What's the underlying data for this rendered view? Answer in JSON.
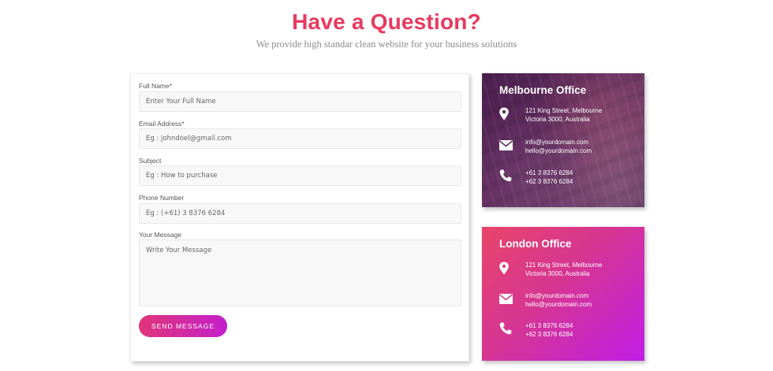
{
  "header": {
    "title": "Have a Question?",
    "subtitle": "We provide high standar clean website for your business solutions"
  },
  "form": {
    "fields": [
      {
        "label": "Full Name*",
        "placeholder": "Enter Your Full Name"
      },
      {
        "label": "Email Address*",
        "placeholder": "Eg : johndoel@gmail.com"
      },
      {
        "label": "Subject",
        "placeholder": "Eg : How to purchase"
      },
      {
        "label": "Phone Number",
        "placeholder": "Eg : (+61) 3 8376 6284"
      }
    ],
    "message": {
      "label": "Your Message",
      "placeholder": "Write Your Message"
    },
    "submit_label": "SEND MESSAGE"
  },
  "offices": [
    {
      "title": "Melbourne Office",
      "address": [
        "121 King Street, Melbourne",
        "Victoria 3000, Australia"
      ],
      "emails": [
        "info@yourdomain.com",
        "hello@yourdomain.com"
      ],
      "phones": [
        "+61 3 8376 6284",
        "+62 3 8376 6284"
      ]
    },
    {
      "title": "London Office",
      "address": [
        "121 King Street, Melbourne",
        "Victoria 3000, Australia"
      ],
      "emails": [
        "info@yourdomain.com",
        "hello@yourdomain.com"
      ],
      "phones": [
        "+61 3 8376 6284",
        "+62 3 8376 6284"
      ]
    }
  ],
  "icons": {
    "address": "map-marker-icon",
    "email": "envelope-icon",
    "phone": "phone-icon"
  },
  "colors": {
    "accent": "#e8395f",
    "button_gradient_start": "#e0357a",
    "button_gradient_end": "#c41fcc",
    "london_gradient_start": "#e8456a",
    "london_gradient_end": "#c01ee6",
    "melbourne_overlay": "#4a1f4e"
  }
}
